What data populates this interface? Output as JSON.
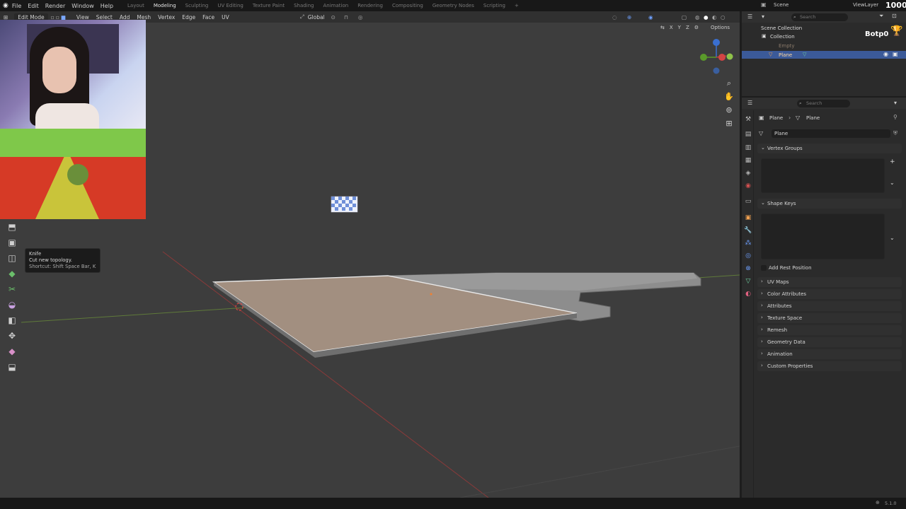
{
  "topbar": {
    "menu": [
      "File",
      "Edit",
      "Render",
      "Window",
      "Help"
    ],
    "workspaces": [
      "Layout",
      "Modeling",
      "Sculpting",
      "UV Editing",
      "Texture Paint",
      "Shading",
      "Animation",
      "Rendering",
      "Compositing",
      "Geometry Nodes",
      "Scripting"
    ],
    "active_workspace": "Modeling",
    "scene": "Scene",
    "view_layer": "ViewLayer"
  },
  "viewport_header": {
    "mode": "Edit Mode",
    "menus": [
      "View",
      "Select",
      "Add",
      "Mesh",
      "Vertex",
      "Edge",
      "Face",
      "UV"
    ],
    "orientation": "Global",
    "axes": [
      "X",
      "Y",
      "Z"
    ],
    "options": "Options"
  },
  "tooltip": {
    "title": "Knife",
    "description": "Cut new topology.",
    "shortcut": "Shortcut: Shift Space Bar, K"
  },
  "overlay": {
    "badge": "Botp0",
    "count": "1000"
  },
  "outliner": {
    "search_placeholder": "Search",
    "scene_collection": "Scene Collection",
    "collection": "Collection",
    "items": [
      "Empty",
      "Plane"
    ]
  },
  "properties": {
    "search_placeholder": "Search",
    "breadcrumb": [
      "Plane",
      "Plane"
    ],
    "mesh_name": "Plane",
    "panels": {
      "vertex_groups": "Vertex Groups",
      "shape_keys": "Shape Keys",
      "add_rest_position": "Add Rest Position"
    },
    "collapsed_panels": [
      "UV Maps",
      "Color Attributes",
      "Attributes",
      "Texture Space",
      "Remesh",
      "Geometry Data",
      "Animation",
      "Custom Properties"
    ]
  },
  "status": {
    "version": "5.1.0"
  }
}
